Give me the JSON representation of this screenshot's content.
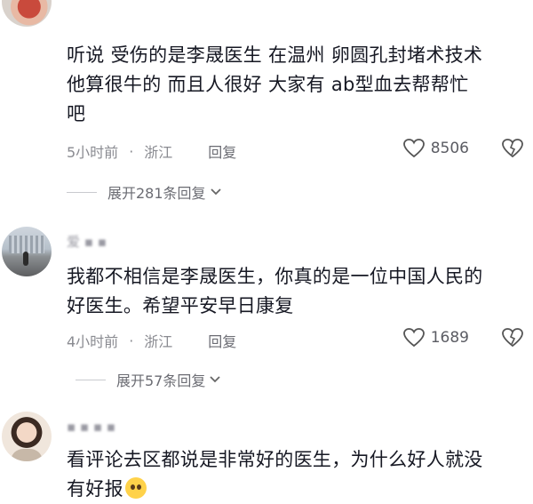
{
  "comments": [
    {
      "username": "",
      "text_lines": [
        "听说 受伤的是李晟医生  在温州 卵圆孔封堵术技术",
        "他算很牛的  而且人很好    大家有 ab型血去帮帮忙",
        "吧"
      ],
      "time": "5小时前",
      "location": "浙江",
      "reply_label": "回复",
      "likes": "8506",
      "expand_label": "展开281条回复"
    },
    {
      "username": "爱 ▪ ▪",
      "text_lines": [
        "我都不相信是李晟医生，你真的是一位中国人民的",
        "好医生。希望平安早日康复"
      ],
      "time": "4小时前",
      "location": "浙江",
      "reply_label": "回复",
      "likes": "1689",
      "expand_label": "展开57条回复"
    },
    {
      "username": "▪ ▪ ▪ ▪",
      "text_lines": [
        "看评论去区都说是非常好的医生，为什么好人就没",
        "有好报"
      ],
      "emoji": "pleading-face-emoji"
    }
  ],
  "icons": {
    "like": "heart-outline-icon",
    "dislike": "broken-heart-icon",
    "expand": "chevron-down-icon"
  },
  "colors": {
    "text": "#161823",
    "meta": "#8a8b91",
    "divider": "#c9cacf"
  }
}
